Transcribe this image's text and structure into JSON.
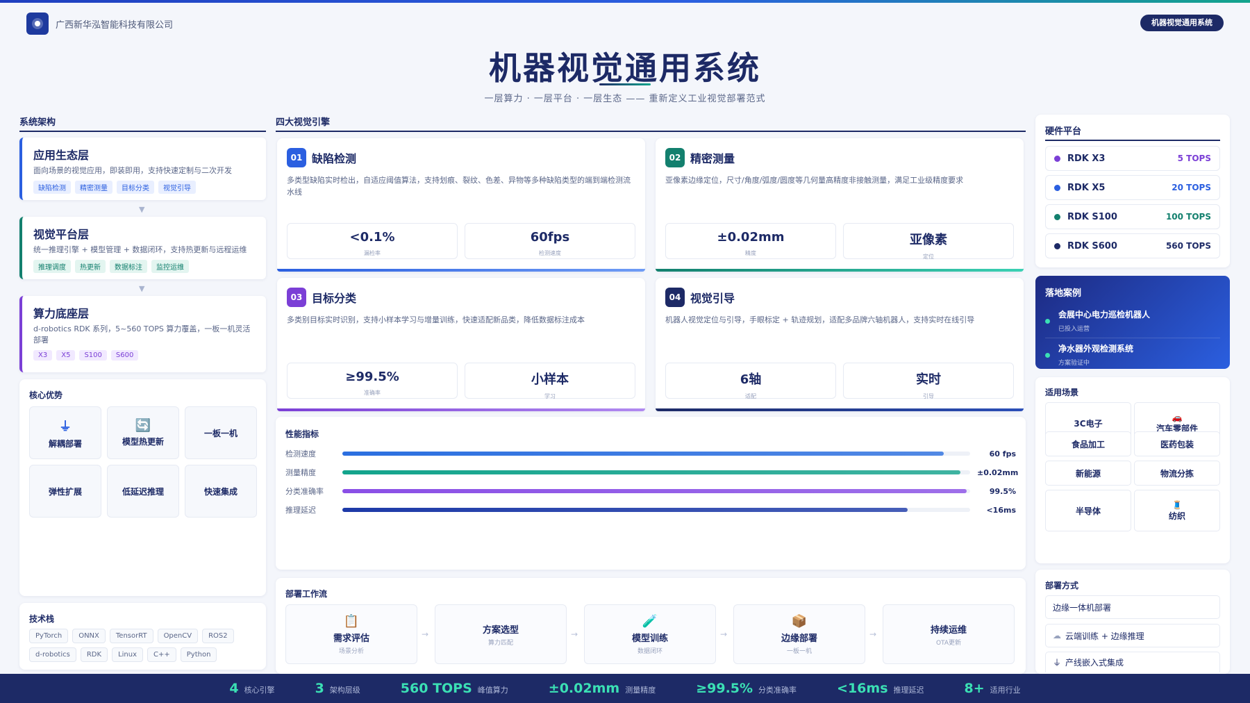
{
  "header": {
    "company": "广西新华泓智能科技有限公司",
    "badge": "机器视觉通用系统",
    "title": "机器视觉通用系统",
    "subtitle": "一层算力 · 一层平台 · 一层生态 —— 重新定义工业视觉部署范式"
  },
  "arch": {
    "heading": "系统架构",
    "layers": [
      {
        "name": "应用生态层",
        "desc": "面向场景的视觉应用，即装即用，支持快速定制与二次开发",
        "tags": [
          "缺陷检测",
          "精密测量",
          "目标分类",
          "视觉引导"
        ]
      },
      {
        "name": "视觉平台层",
        "desc": "统一推理引擎 + 模型管理 + 数据闭环，支持热更新与远程运维",
        "tags": [
          "推理调度",
          "热更新",
          "数据标注",
          "监控运维"
        ]
      },
      {
        "name": "算力底座层",
        "desc": "d-robotics RDK 系列，5~560 TOPS 算力覆盖，一板一机灵活部署",
        "tags": [
          "X3",
          "X5",
          "S100",
          "S600"
        ]
      }
    ],
    "arrow": "▼"
  },
  "advantages": {
    "heading": "核心优势",
    "items": [
      {
        "icon": "plug-icon",
        "glyph": "⏚",
        "label": "解耦部署"
      },
      {
        "icon": "refresh-icon",
        "glyph": "🔄",
        "label": "模型热更新"
      },
      {
        "icon": "",
        "glyph": "",
        "label": "一板一机"
      },
      {
        "icon": "",
        "glyph": "",
        "label": "弹性扩展"
      },
      {
        "icon": "",
        "glyph": "",
        "label": "低延迟推理"
      },
      {
        "icon": "",
        "glyph": "",
        "label": "快速集成"
      }
    ]
  },
  "tech": {
    "heading": "技术栈",
    "items": [
      "PyTorch",
      "ONNX",
      "TensorRT",
      "OpenCV",
      "ROS2",
      "d-robotics",
      "RDK",
      "Linux",
      "C++",
      "Python"
    ]
  },
  "engines": {
    "heading": "四大视觉引擎",
    "items": [
      {
        "num": "01",
        "name": "缺陷检测",
        "color": "#2b5fe0",
        "desc": "多类型缺陷实时检出，自适应阈值算法，支持划痕、裂纹、色差、异物等多种缺陷类型的端到端检测流水线",
        "s1v": "<0.1%",
        "s1l": "漏检率",
        "s2v": "60fps",
        "s2l": "检测速度"
      },
      {
        "num": "02",
        "name": "精密测量",
        "color": "#13806e",
        "desc": "亚像素边缘定位，尺寸/角度/弧度/圆度等几何量高精度非接触测量，满足工业级精度要求",
        "s1v": "±0.02mm",
        "s1l": "精度",
        "s2v": "亚像素",
        "s2l": "定位"
      },
      {
        "num": "03",
        "name": "目标分类",
        "color": "#7b3fd6",
        "desc": "多类别目标实时识别，支持小样本学习与增量训练，快速适配新品类，降低数据标注成本",
        "s1v": "≥99.5%",
        "s1l": "准确率",
        "s2v": "小样本",
        "s2l": "学习"
      },
      {
        "num": "04",
        "name": "视觉引导",
        "color": "#1d2a66",
        "desc": "机器人视觉定位与引导，手眼标定 + 轨迹规划，适配多品牌六轴机器人，支持实时在线引导",
        "s1v": "6轴",
        "s1l": "适配",
        "s2v": "实时",
        "s2l": "引导"
      }
    ]
  },
  "performance": {
    "heading": "性能指标",
    "rows": [
      {
        "label": "检测速度",
        "value": "60 fps",
        "level": 0.958,
        "color": "#2b6fe0"
      },
      {
        "label": "测量精度",
        "value": "±0.02mm",
        "level": 0.985,
        "color": "#13a48c"
      },
      {
        "label": "分类准确率",
        "value": "99.5%",
        "level": 0.995,
        "color": "#8a4fe6"
      },
      {
        "label": "推理延迟",
        "value": "<16ms",
        "level": 0.9,
        "color": "#1d3aa8"
      }
    ]
  },
  "workflow": {
    "heading": "部署工作流",
    "steps": [
      {
        "icon": "clipboard-icon",
        "glyph": "📋",
        "name": "需求评估",
        "sub": "场景分析"
      },
      {
        "icon": "",
        "glyph": "",
        "name": "方案选型",
        "sub": "算力匹配"
      },
      {
        "icon": "test-tube-icon",
        "glyph": "🧪",
        "name": "模型训练",
        "sub": "数据闭环"
      },
      {
        "icon": "package-icon",
        "glyph": "📦",
        "name": "边缘部署",
        "sub": "一板一机"
      },
      {
        "icon": "",
        "glyph": "",
        "name": "持续运维",
        "sub": "OTA更新"
      }
    ],
    "arrow": "→"
  },
  "hardware": {
    "heading": "硬件平台",
    "items": [
      {
        "name": "RDK X3",
        "tops": "5 TOPS",
        "color": "#7b3fd6"
      },
      {
        "name": "RDK X5",
        "tops": "20 TOPS",
        "color": "#2b5fe0"
      },
      {
        "name": "RDK S100",
        "tops": "100 TOPS",
        "color": "#13806e"
      },
      {
        "name": "RDK S600",
        "tops": "560 TOPS",
        "color": "#1d2a66"
      }
    ]
  },
  "cases": {
    "heading": "落地案例",
    "items": [
      {
        "name": "会展中心电力巡检机器人",
        "status": "已投入运营"
      },
      {
        "name": "净水器外观检测系统",
        "status": "方案验证中"
      }
    ]
  },
  "scenes": {
    "heading": "适用场景",
    "items": [
      {
        "label": "3C电子",
        "glyph": ""
      },
      {
        "label": "汽车零部件",
        "glyph": "🚗"
      },
      {
        "label": "食品加工",
        "glyph": ""
      },
      {
        "label": "医药包装",
        "glyph": ""
      },
      {
        "label": "新能源",
        "glyph": ""
      },
      {
        "label": "物流分拣",
        "glyph": ""
      },
      {
        "label": "半导体",
        "glyph": ""
      },
      {
        "label": "纺织",
        "glyph": "🧵"
      }
    ]
  },
  "deploy": {
    "heading": "部署方式",
    "items": [
      {
        "glyph": "",
        "label": "边缘一体机部署"
      },
      {
        "glyph": "☁",
        "label": "云端训练 + 边缘推理"
      },
      {
        "glyph": "⏚",
        "label": "产线嵌入式集成"
      }
    ]
  },
  "stats": [
    {
      "value": "4",
      "label": "核心引擎"
    },
    {
      "value": "3",
      "label": "架构层级"
    },
    {
      "value": "560 TOPS",
      "label": "峰值算力"
    },
    {
      "value": "±0.02mm",
      "label": "测量精度"
    },
    {
      "value": "≥99.5%",
      "label": "分类准确率"
    },
    {
      "value": "<16ms",
      "label": "推理延迟"
    },
    {
      "value": "8+",
      "label": "适用行业"
    }
  ],
  "colors": {
    "navy": "#1d2a66",
    "blue": "#2b5fe0",
    "teal": "#13806e",
    "purple": "#7b3fd6"
  }
}
